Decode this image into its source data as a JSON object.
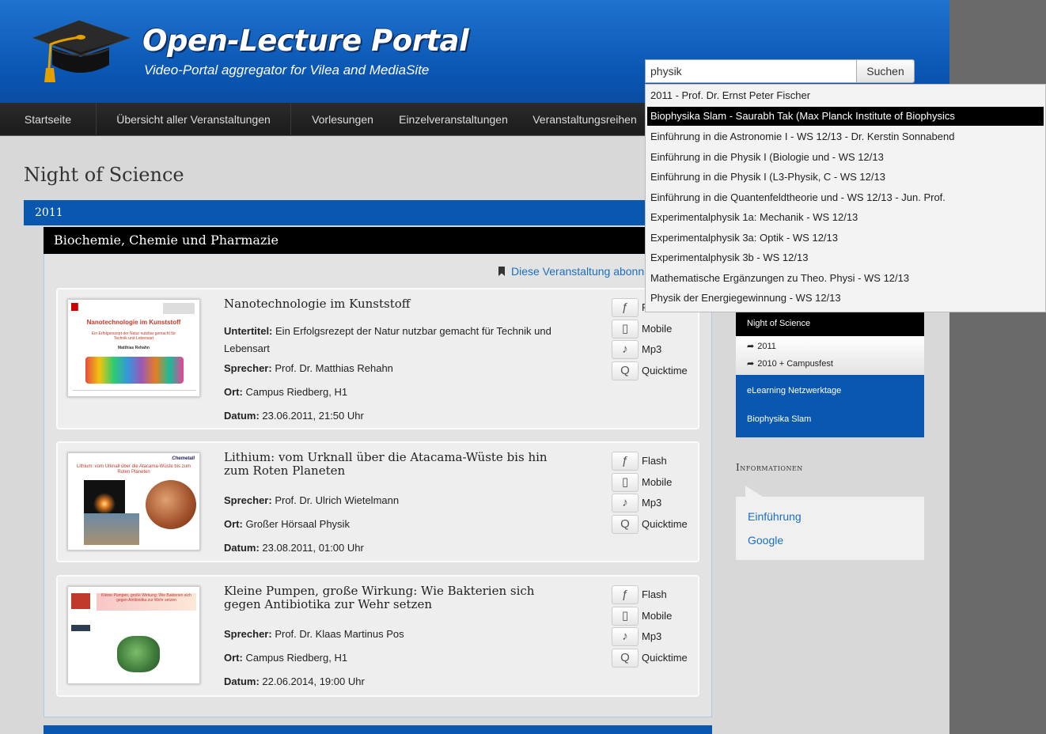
{
  "site": {
    "title": "Open-Lecture Portal",
    "subtitle": "Video-Portal aggregator for Vilea and MediaSite"
  },
  "search": {
    "value": "physik",
    "button": "Suchen"
  },
  "nav": [
    "Startseite",
    "Übersicht aller Veranstaltungen",
    "Vorlesungen",
    "Einzelveranstaltungen",
    "Veranstaltungsreihen"
  ],
  "page_title": "Night of Science",
  "year": "2011",
  "section": "Biochemie, Chemie und Pharmazie",
  "subscribe": "Diese Veranstaltung abonn",
  "media_labels": [
    "Flash",
    "Mobile",
    "Mp3",
    "Quicktime"
  ],
  "lectures": [
    {
      "title": "Nanotechnologie im Kunststoff",
      "untertitel_label": "Untertitel:",
      "untertitel": "Ein Erfolgsrezept der Natur nutzbar gemacht für Technik und Lebensart",
      "sprecher_label": "Sprecher:",
      "sprecher": "Prof. Dr. Matthias Rehahn",
      "ort_label": "Ort:",
      "ort": "Campus Riedberg, H1",
      "datum_label": "Datum:",
      "datum": "23.06.2011, 21:50 Uhr",
      "thumb": {
        "heading": "Nanotechnologie im Kunststoff",
        "sub": "Ein Erfolgsrezept der Natur nutzbar gemacht für Technik und Lebensart",
        "author": "Matthias Rehahn"
      }
    },
    {
      "title": "Lithium: vom Urknall über die Atacama-Wüste bis hin zum Roten Planeten",
      "sprecher_label": "Sprecher:",
      "sprecher": "Prof. Dr. Ulrich Wietelmann",
      "ort_label": "Ort:",
      "ort": "Großer Hörsaal Physik",
      "datum_label": "Datum:",
      "datum": "23.08.2011, 01:00 Uhr",
      "thumb": {
        "brand": "Chemetall",
        "heading": "Lithium: vom Urknall über die Atacama-Wüste bis zum Roten Planeten"
      }
    },
    {
      "title": "Kleine Pumpen, große Wirkung: Wie Bakterien sich gegen Antibiotika zur Wehr setzen",
      "sprecher_label": "Sprecher:",
      "sprecher": "Prof. Dr. Klaas Martinus Pos",
      "ort_label": "Ort:",
      "ort": "Campus Riedberg, H1",
      "datum_label": "Datum:",
      "datum": "22.06.2014, 19:00 Uhr",
      "thumb": {
        "heading": "Kleine Pumpen, große Wirkung: Wie Bakterien sich gegen Antibiotika zur Wehr setzen"
      }
    }
  ],
  "sidebar": {
    "active": "Night of Science",
    "sub": [
      "2011",
      "2010 + Campusfest"
    ],
    "items": [
      "eLearning Netzwerktage",
      "Biophysika Slam"
    ],
    "info_title": "Informationen",
    "info_links": [
      "Einführung",
      "Google"
    ]
  },
  "autocomplete": {
    "selected_index": 1,
    "items": [
      "2011 - Prof. Dr. Ernst Peter Fischer",
      "Biophysika Slam - Saurabh Tak (Max Planck Institute of Biophysics",
      "Einführung in die Astronomie I - WS 12/13 - Dr. Kerstin Sonnabend",
      "Einführung in die Physik I (Biologie und - WS 12/13",
      "Einführung in die Physik I (L3-Physik, C - WS 12/13",
      "Einführung in die Quantenfeldtheorie und - WS 12/13 - Jun. Prof.",
      "Experimentalphysik 1a: Mechanik - WS 12/13",
      "Experimentalphysik 3a: Optik - WS 12/13",
      "Experimentalphysik 3b - WS 12/13",
      "Mathematische Ergänzungen zu Theo. Physi - WS 12/13",
      "Physik der Energiegewinnung - WS 12/13"
    ]
  },
  "colors": {
    "header_blue": "#0a56b3",
    "nav_dark": "#222222",
    "link_blue": "#1a6fc0",
    "section_black": "#000000"
  }
}
